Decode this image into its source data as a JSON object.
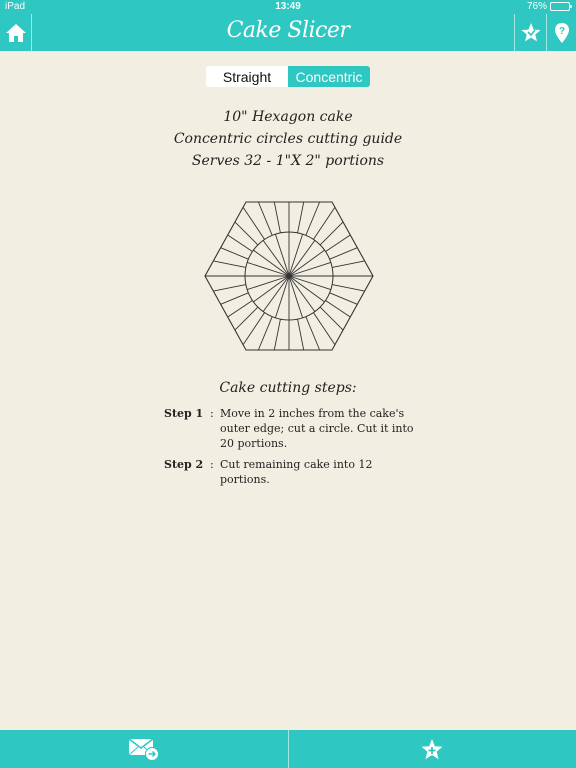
{
  "status_bar": {
    "device": "iPad",
    "time": "13:49",
    "battery": "76%",
    "battery_level": 0.76
  },
  "nav": {
    "title": "Cake Slicer",
    "home_icon": "home-icon",
    "favorite_icon": "star-icon",
    "help_icon": "help-pin-icon"
  },
  "segments": {
    "straight": "Straight",
    "concentric": "Concentric",
    "selected": "Concentric"
  },
  "guide": {
    "line1": "10\" Hexagon cake",
    "line2": "Concentric circles cutting guide",
    "line3": "Serves 32 - 1\"X 2\" portions"
  },
  "steps": {
    "title": "Cake cutting steps:",
    "items": [
      {
        "label": "Step 1",
        "colon": ":",
        "text": "Move in 2 inches from the cake's outer edge; cut a circle. Cut it into 20 portions."
      },
      {
        "label": "Step 2",
        "colon": ":",
        "text": "Cut remaining cake into 12 portions."
      }
    ]
  },
  "toolbar": {
    "email_icon": "email-send-icon",
    "favorites_icon": "add-favorite-star-icon"
  },
  "colors": {
    "accent": "#2ec7c2",
    "background": "#f2eee1",
    "line": "#333333"
  }
}
